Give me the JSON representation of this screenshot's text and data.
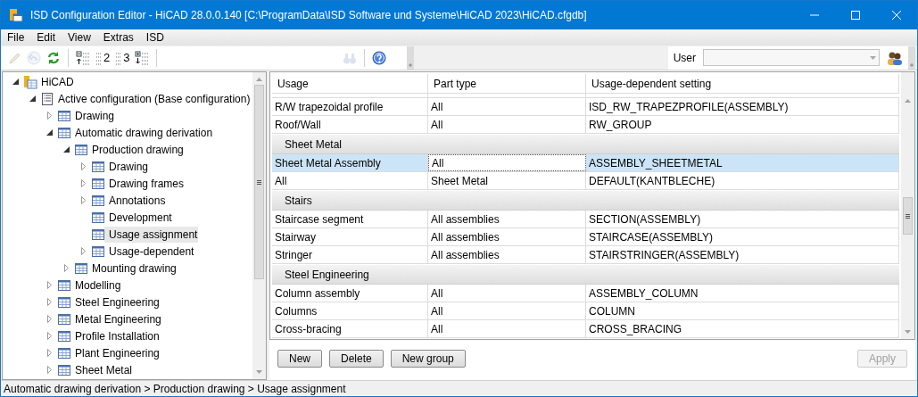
{
  "window": {
    "title": "ISD Configuration Editor  - HiCAD 28.0.0.140 [C:\\ProgramData\\ISD Software und Systeme\\HiCAD 2023\\HiCAD.cfgdb]"
  },
  "menu": [
    "File",
    "Edit",
    "View",
    "Extras",
    "ISD"
  ],
  "toolbar": [
    {
      "kind": "pencil",
      "disabled": true
    },
    {
      "kind": "undo",
      "disabled": true
    },
    {
      "kind": "refresh",
      "disabled": false
    },
    {
      "kind": "sep"
    },
    {
      "kind": "level-up",
      "disabled": false
    },
    {
      "kind": "level",
      "label": "2",
      "disabled": false
    },
    {
      "kind": "level",
      "label": "3",
      "disabled": false
    },
    {
      "kind": "level-down",
      "disabled": false
    },
    {
      "kind": "sep"
    },
    {
      "kind": "gap"
    },
    {
      "kind": "find",
      "disabled": true
    },
    {
      "kind": "sep"
    },
    {
      "kind": "help",
      "disabled": false
    }
  ],
  "user": {
    "label": "User",
    "disabled": true
  },
  "tree": [
    {
      "label": "HiCAD",
      "kind": "root",
      "expanded": true,
      "selected": false,
      "children": [
        {
          "label": "Active configuration (Base configuration)",
          "kind": "config",
          "expanded": true,
          "selected": false,
          "children": [
            {
              "label": "Drawing",
              "kind": "table",
              "expanded": false,
              "selected": false
            },
            {
              "label": "Automatic drawing derivation",
              "kind": "table",
              "expanded": true,
              "selected": false,
              "children": [
                {
                  "label": "Production drawing",
                  "kind": "table",
                  "expanded": true,
                  "selected": false,
                  "children": [
                    {
                      "label": "Drawing",
                      "kind": "table",
                      "expanded": false,
                      "selected": false
                    },
                    {
                      "label": "Drawing frames",
                      "kind": "table",
                      "expanded": false,
                      "selected": false
                    },
                    {
                      "label": "Annotations",
                      "kind": "table",
                      "expanded": false,
                      "selected": false
                    },
                    {
                      "label": "Development",
                      "kind": "table",
                      "selected": false
                    },
                    {
                      "label": "Usage assignment",
                      "kind": "table",
                      "selected": true
                    },
                    {
                      "label": "Usage-dependent",
                      "kind": "table",
                      "expanded": false,
                      "selected": false
                    }
                  ]
                },
                {
                  "label": "Mounting drawing",
                  "kind": "table",
                  "expanded": false,
                  "selected": false
                }
              ]
            },
            {
              "label": "Modelling",
              "kind": "table",
              "expanded": false,
              "selected": false
            },
            {
              "label": "Steel Engineering",
              "kind": "table",
              "expanded": false,
              "selected": false
            },
            {
              "label": "Metal Engineering",
              "kind": "table",
              "expanded": false,
              "selected": false
            },
            {
              "label": "Profile Installation",
              "kind": "table",
              "expanded": false,
              "selected": false
            },
            {
              "label": "Plant Engineering",
              "kind": "table",
              "expanded": false,
              "selected": false
            },
            {
              "label": "Sheet Metal",
              "kind": "table",
              "expanded": false,
              "selected": false
            }
          ]
        }
      ]
    }
  ],
  "table": {
    "columns": [
      "Usage",
      "Part type",
      "Usage-dependent setting"
    ],
    "rows": [
      {
        "kind": "row",
        "cells": [
          "R/W trapezoidal profile",
          "All",
          "ISD_RW_TRAPEZPROFILE(ASSEMBLY)"
        ],
        "selected": false
      },
      {
        "kind": "row",
        "cells": [
          "Roof/Wall",
          "All",
          "RW_GROUP"
        ],
        "selected": false
      },
      {
        "kind": "group",
        "label": "Sheet Metal"
      },
      {
        "kind": "row",
        "cells": [
          "Sheet Metal Assembly",
          "All",
          "ASSEMBLY_SHEETMETAL"
        ],
        "selected": true
      },
      {
        "kind": "row",
        "cells": [
          "All",
          "Sheet Metal",
          "DEFAULT(KANTBLECHE)"
        ],
        "selected": false
      },
      {
        "kind": "group",
        "label": "Stairs"
      },
      {
        "kind": "row",
        "cells": [
          "Staircase segment",
          "All assemblies",
          "SECTION(ASSEMBLY)"
        ],
        "selected": false
      },
      {
        "kind": "row",
        "cells": [
          "Stairway",
          "All assemblies",
          "STAIRCASE(ASSEMBLY)"
        ],
        "selected": false
      },
      {
        "kind": "row",
        "cells": [
          "Stringer",
          "All assemblies",
          "STAIRSTRINGER(ASSEMBLY)"
        ],
        "selected": false
      },
      {
        "kind": "group",
        "label": "Steel Engineering"
      },
      {
        "kind": "row",
        "cells": [
          "Column assembly",
          "All",
          "ASSEMBLY_COLUMN"
        ],
        "selected": false
      },
      {
        "kind": "row",
        "cells": [
          "Columns",
          "All",
          "COLUMN"
        ],
        "selected": false
      },
      {
        "kind": "row",
        "cells": [
          "Cross-bracing",
          "All",
          "CROSS_BRACING"
        ],
        "selected": false
      }
    ]
  },
  "buttons": [
    {
      "label": "New",
      "disabled": false
    },
    {
      "label": "Delete",
      "disabled": false
    },
    {
      "label": "New group",
      "disabled": false
    }
  ],
  "apply": {
    "label": "Apply",
    "disabled": true
  },
  "status_bar": "Automatic drawing derivation > Production drawing > Usage assignment"
}
